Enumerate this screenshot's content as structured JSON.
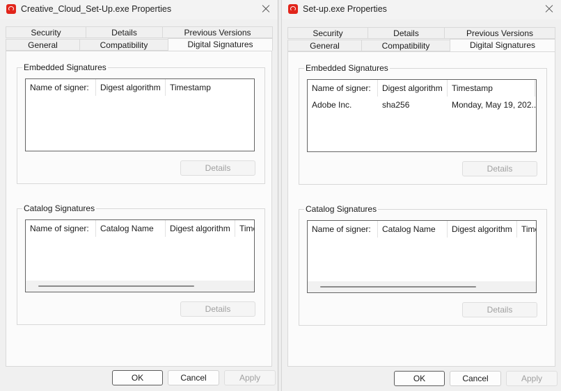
{
  "dialogs": [
    {
      "title": "Creative_Cloud_Set-Up.exe Properties",
      "tabs_row1": [
        "Security",
        "Details",
        "Previous Versions"
      ],
      "tabs_row2": [
        "General",
        "Compatibility",
        "Digital Signatures"
      ],
      "active_tab": "Digital Signatures",
      "embedded": {
        "label": "Embedded Signatures",
        "columns": [
          "Name of signer:",
          "Digest algorithm",
          "Timestamp"
        ],
        "rows": [],
        "details_label": "Details"
      },
      "catalog": {
        "label": "Catalog Signatures",
        "columns": [
          "Name of signer:",
          "Catalog Name",
          "Digest algorithm",
          "Time"
        ],
        "rows": [],
        "details_label": "Details"
      },
      "buttons": {
        "ok": "OK",
        "cancel": "Cancel",
        "apply": "Apply"
      }
    },
    {
      "title": "Set-up.exe Properties",
      "tabs_row1": [
        "Security",
        "Details",
        "Previous Versions"
      ],
      "tabs_row2": [
        "General",
        "Compatibility",
        "Digital Signatures"
      ],
      "active_tab": "Digital Signatures",
      "embedded": {
        "label": "Embedded Signatures",
        "columns": [
          "Name of signer:",
          "Digest algorithm",
          "Timestamp"
        ],
        "rows": [
          [
            "Adobe Inc.",
            "sha256",
            "Monday, May 19, 202..."
          ]
        ],
        "details_label": "Details"
      },
      "catalog": {
        "label": "Catalog Signatures",
        "columns": [
          "Name of signer:",
          "Catalog Name",
          "Digest algorithm",
          "Time"
        ],
        "rows": [],
        "details_label": "Details"
      },
      "buttons": {
        "ok": "OK",
        "cancel": "Cancel",
        "apply": "Apply"
      }
    }
  ],
  "colors": {
    "app_icon": "#e1251b",
    "active_tab_bg": "#fbfbfb",
    "dialog_bg": "#f0f0f0",
    "disabled_text": "#a0a0a0"
  },
  "icons": {
    "app": "adobe-creative-cloud-icon",
    "close": "close-icon"
  }
}
